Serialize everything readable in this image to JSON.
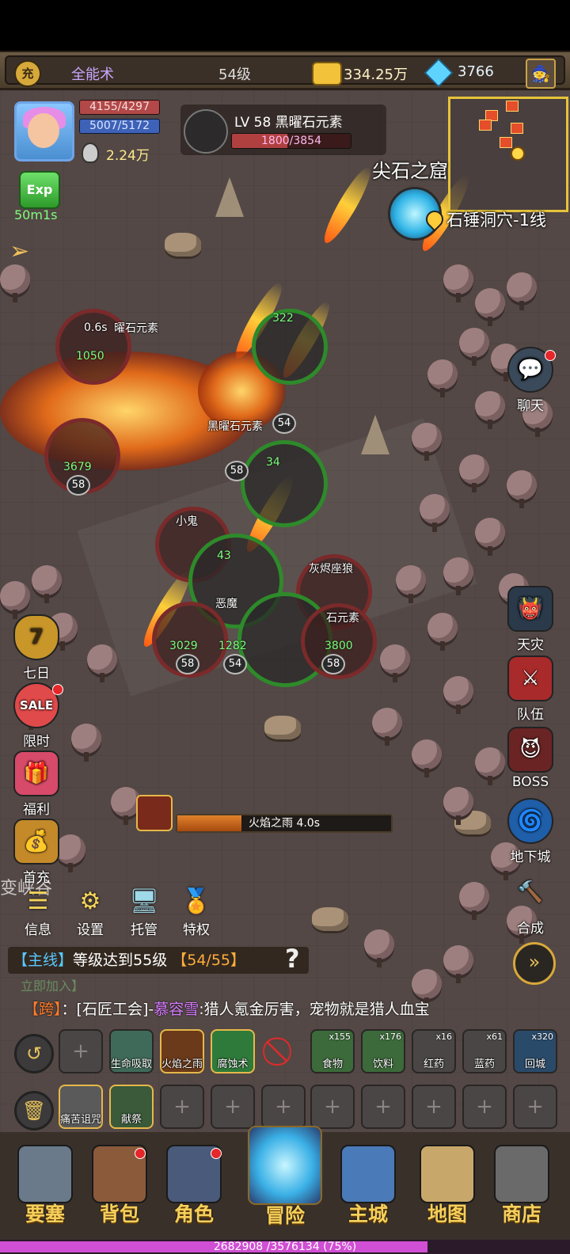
{
  "top_bar": {
    "emblem": "充",
    "skill_name": "全能术",
    "level": "54级",
    "gold": "334.25万",
    "gems": "3766",
    "icons": [
      "gold-coin-icon",
      "diamond-icon",
      "wizard-hat-icon"
    ]
  },
  "player": {
    "hp": "4155/4297",
    "mp": "5007/5172",
    "power": "2.24万"
  },
  "target": {
    "name": "LV 58 黑曜石元素",
    "hp": "1800/3854",
    "hp_fraction": 0.467
  },
  "buff": {
    "label": "Exp",
    "timer": "50m1s"
  },
  "zone": {
    "area_name": "尖石之窟",
    "location": "石锤洞穴-1线"
  },
  "right_buttons": [
    {
      "label": "聊天",
      "icon": "chat-bubble-icon"
    },
    {
      "label": "天灾",
      "icon": "skull-mask-icon"
    },
    {
      "label": "队伍",
      "icon": "banner-icon"
    },
    {
      "label": "BOSS",
      "icon": "demon-head-icon"
    },
    {
      "label": "地下城",
      "icon": "swirl-gem-icon"
    },
    {
      "label": "合成",
      "icon": "hammer-icon"
    }
  ],
  "left_buttons": [
    {
      "label": "七日",
      "badge": "7"
    },
    {
      "label": "限时",
      "badge": "SALE"
    },
    {
      "label": "福利"
    },
    {
      "label": "首充"
    }
  ],
  "battle": {
    "units": [
      {
        "label": "曜石元素",
        "hp": "1050",
        "level": "",
        "timer": "0.6s"
      },
      {
        "label": "黑曜石元素",
        "hp": "3679",
        "level": "58"
      },
      {
        "label": "",
        "hp": "322",
        "level": "54"
      },
      {
        "label": "",
        "hp": "34",
        "level": "58"
      },
      {
        "label": "小鬼",
        "hp": "",
        "level": ""
      },
      {
        "label": "灰烬座狼",
        "hp": "",
        "level": ""
      },
      {
        "label": "石元素",
        "hp": "3800",
        "level": "58"
      },
      {
        "label": "",
        "hp": "3029",
        "level": "58"
      },
      {
        "label": "",
        "hp": "1282",
        "level": "54"
      },
      {
        "label": "恶魔",
        "hp": "43",
        "level": "54"
      }
    ]
  },
  "cast": {
    "skill": "火焰之雨",
    "time": "4.0s",
    "progress": 0.3
  },
  "faded_text": "变峡谷",
  "quick_buttons": [
    {
      "label": "信息"
    },
    {
      "label": "设置"
    },
    {
      "label": "托管"
    },
    {
      "label": "特权"
    }
  ],
  "quest": {
    "tag": "【主线】",
    "text": "等级达到55级",
    "progress": "【54/55】"
  },
  "join_hint": "立即加入】",
  "chat": {
    "channel": "【跨】",
    "sep": "：",
    "guild": "[石匠工会]-",
    "name": "慕容雪",
    "message": ":猎人氪金厉害，宠物就是猎人血宝"
  },
  "skill_bar": {
    "skills": [
      {
        "label": "",
        "kind": "empty"
      },
      {
        "label": "生命吸取"
      },
      {
        "label": "火焰之雨"
      },
      {
        "label": "腐蚀术"
      }
    ],
    "items": [
      {
        "label": "食物",
        "count": "x155"
      },
      {
        "label": "饮料",
        "count": "x176"
      },
      {
        "label": "红药",
        "count": "x16"
      },
      {
        "label": "蓝药",
        "count": "x61"
      },
      {
        "label": "回城",
        "count": "x320"
      }
    ],
    "row2": [
      {
        "label": "痛苦诅咒"
      },
      {
        "label": "献祭"
      }
    ]
  },
  "bottom_nav": [
    {
      "label": "要塞"
    },
    {
      "label": "背包"
    },
    {
      "label": "角色"
    },
    {
      "label": "冒险"
    },
    {
      "label": "主城"
    },
    {
      "label": "地图"
    },
    {
      "label": "商店"
    }
  ],
  "exp": {
    "text": "2682908 /3576134 (75%)",
    "fraction": 0.75
  },
  "colors": {
    "accent_gold": "#f6cf5a",
    "hp_red": "#b24848",
    "mp_blue": "#3d62b8",
    "exp_purple": "#d04fd4",
    "quest_blue": "#58c8ff",
    "quest_orange": "#ffae3a"
  }
}
